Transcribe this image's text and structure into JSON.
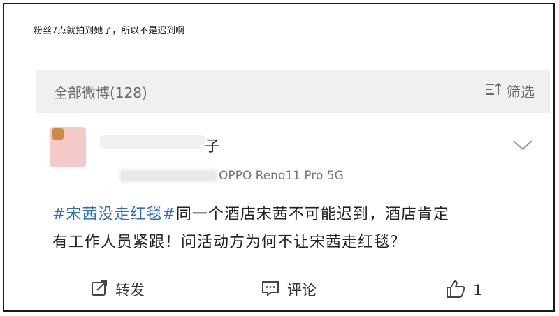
{
  "caption": "粉丝7点就拍到她了，所以不是迟到啊",
  "filter_bar": {
    "title": "全部微博(128)",
    "filter_label": "筛选",
    "filter_icon": "filter-sort-icon"
  },
  "post": {
    "username_visible": "子",
    "source": "OPPO Reno11 Pro 5G",
    "hashtag": "#宋茜没走红毯#",
    "text_line1": "同一个酒店宋茜不可能迟到，酒店肯定",
    "text_line2": "有工作人员紧跟！问活动方为何不让宋茜走红毯？",
    "hashtag_color": "#2f6fb3"
  },
  "actions": {
    "repost_label": "转发",
    "comment_label": "评论",
    "like_count": "1"
  }
}
